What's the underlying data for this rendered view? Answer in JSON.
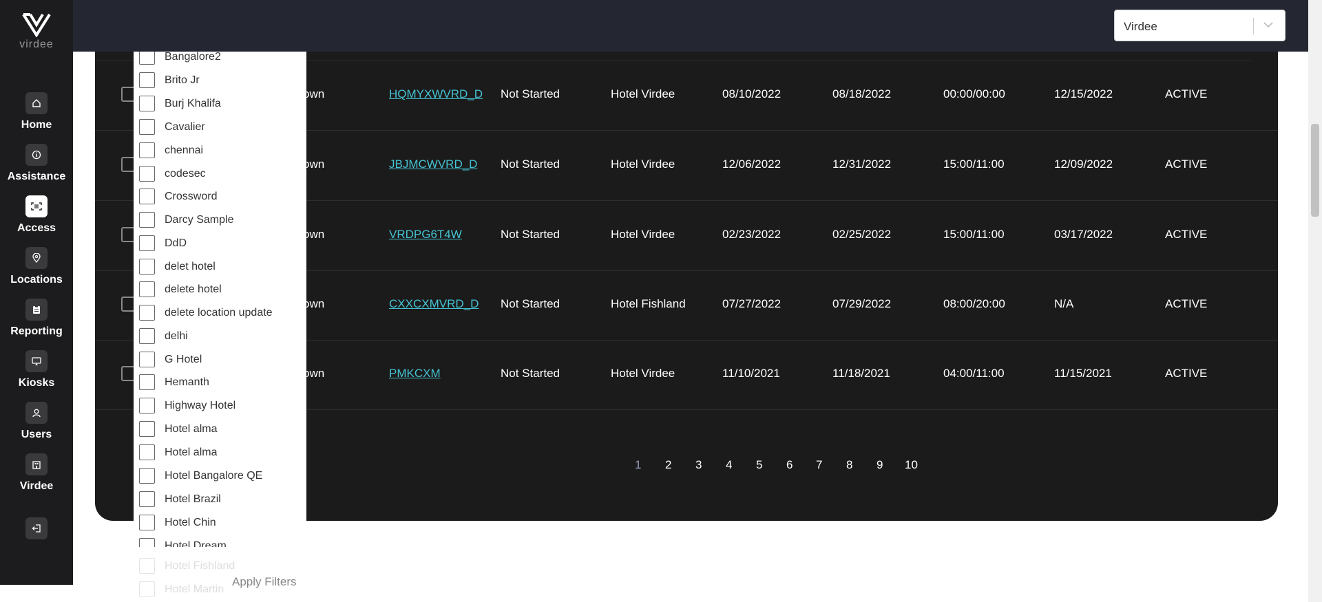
{
  "app": {
    "logo_text": "virdee"
  },
  "sidebar": {
    "items": [
      {
        "label": "Home",
        "icon": "home-icon"
      },
      {
        "label": "Assistance",
        "icon": "info-icon"
      },
      {
        "label": "Access",
        "icon": "scan-icon"
      },
      {
        "label": "Locations",
        "icon": "location-pin-icon"
      },
      {
        "label": "Reporting",
        "icon": "clipboard-icon"
      },
      {
        "label": "Kiosks",
        "icon": "kiosk-icon"
      },
      {
        "label": "Users",
        "icon": "user-icon"
      },
      {
        "label": "Virdee",
        "icon": "building-icon"
      }
    ],
    "logout_icon": "logout-icon"
  },
  "topbar": {
    "select_value": "Virdee"
  },
  "table": {
    "rows": [
      {
        "name_fragment": "own",
        "code": "HQMYXWVRD_D",
        "status": "Not Started",
        "hotel": "Hotel Virdee",
        "start": "08/10/2022",
        "end": "08/18/2022",
        "times": "00:00/00:00",
        "date": "12/15/2022",
        "state": "ACTIVE"
      },
      {
        "name_fragment": "own",
        "code": "JBJMCWVRD_D",
        "status": "Not Started",
        "hotel": "Hotel Virdee",
        "start": "12/06/2022",
        "end": "12/31/2022",
        "times": "15:00/11:00",
        "date": "12/09/2022",
        "state": "ACTIVE"
      },
      {
        "name_fragment": "own",
        "code": "VRDPG6T4W",
        "status": "Not Started",
        "hotel": "Hotel Virdee",
        "start": "02/23/2022",
        "end": "02/25/2022",
        "times": "15:00/11:00",
        "date": "03/17/2022",
        "state": "ACTIVE"
      },
      {
        "name_fragment": "own",
        "code": "CXXCXMVRD_D",
        "status": "Not Started",
        "hotel": "Hotel Fishland",
        "start": "07/27/2022",
        "end": "07/29/2022",
        "times": "08:00/20:00",
        "date": "N/A",
        "state": "ACTIVE"
      },
      {
        "name_fragment": "own",
        "code": "PMKCXM",
        "status": "Not Started",
        "hotel": "Hotel Virdee",
        "start": "11/10/2021",
        "end": "11/18/2021",
        "times": "04:00/11:00",
        "date": "11/15/2021",
        "state": "ACTIVE"
      }
    ]
  },
  "pagination": {
    "pages": [
      "1",
      "2",
      "3",
      "4",
      "5",
      "6",
      "7",
      "8",
      "9",
      "10"
    ],
    "current": "1"
  },
  "filter_dropdown": {
    "options": [
      "Bangalore2",
      "Brito Jr",
      "Burj Khalifa",
      "Cavalier",
      "chennai",
      "codesec",
      "Crossword",
      "Darcy Sample",
      "DdD",
      "delet hotel",
      "delete hotel",
      "delete location update",
      "delhi",
      "G Hotel",
      "Hemanth",
      "Highway Hotel",
      "Hotel alma",
      "Hotel alma",
      "Hotel Bangalore QE",
      "Hotel Brazil",
      "Hotel Chin",
      "Hotel Dream",
      "Hotel Fishland",
      "Hotel Martin"
    ],
    "apply_label": "Apply Filters"
  }
}
